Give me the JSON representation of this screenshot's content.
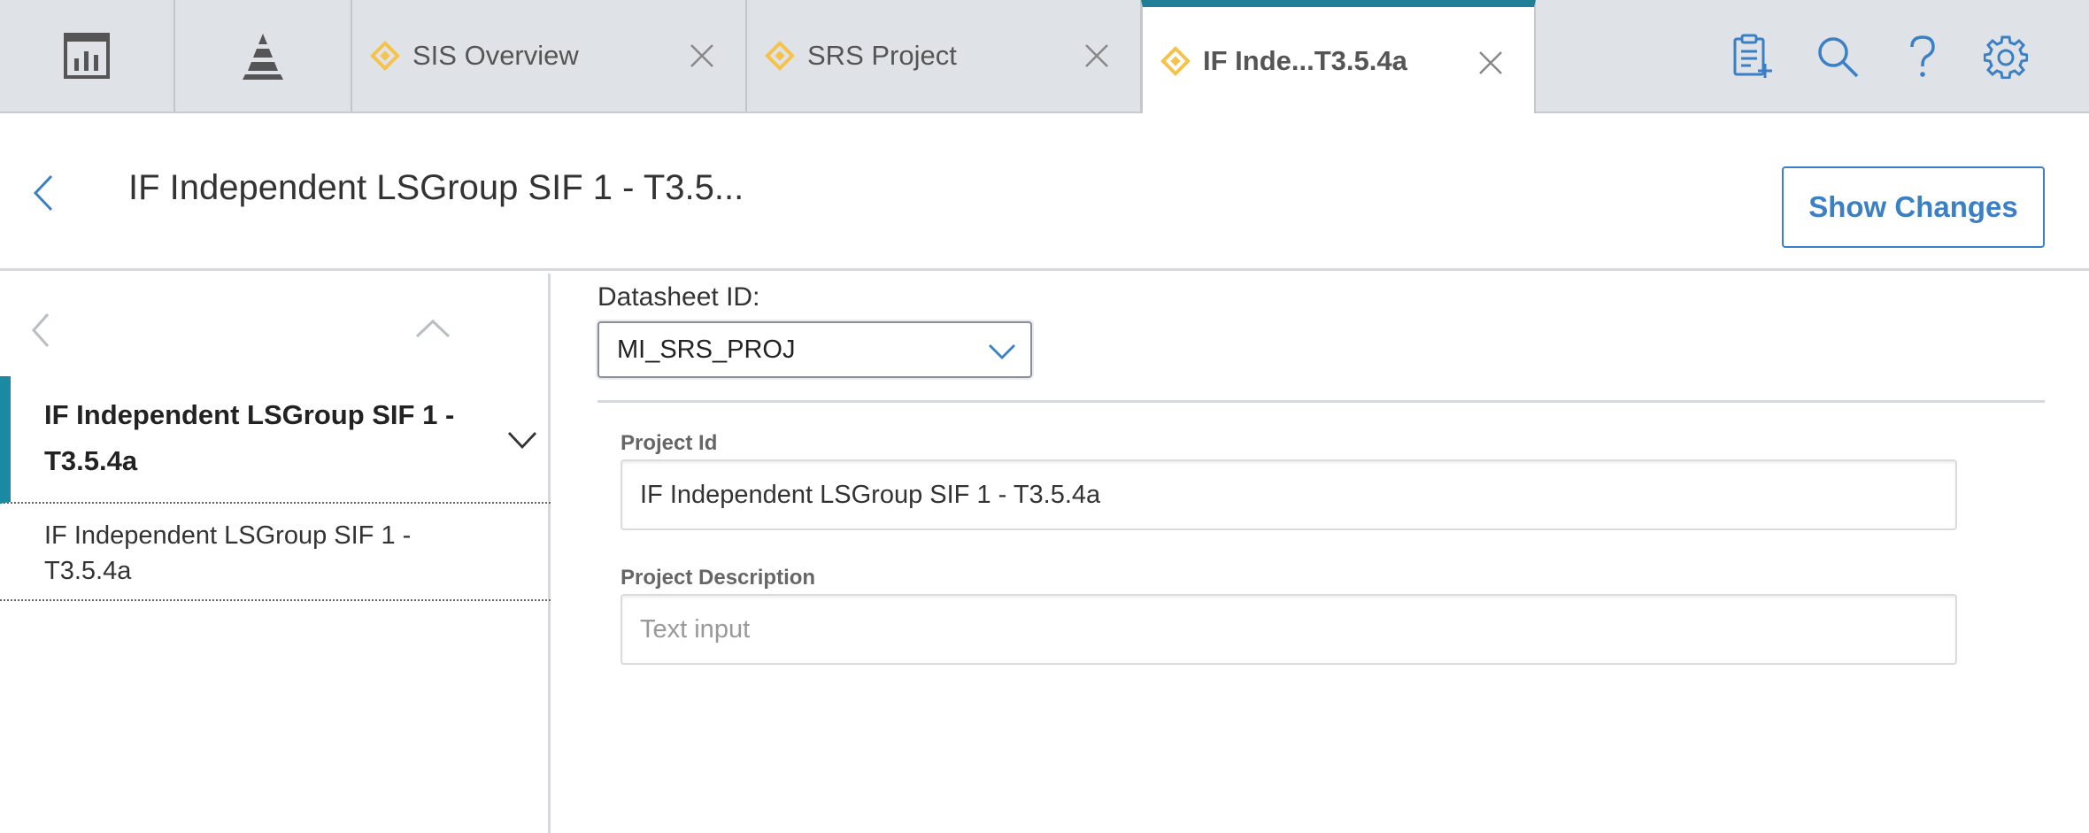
{
  "tabs": {
    "app_tabs": [
      {
        "icon": "dashboard-chart-icon"
      },
      {
        "icon": "pyramid-icon"
      }
    ],
    "documents": [
      {
        "label": "SIS Overview",
        "icon": "diamond-icon",
        "active": false
      },
      {
        "label": "SRS Project",
        "icon": "diamond-icon",
        "active": false
      },
      {
        "label": "IF Inde...T3.5.4a",
        "icon": "diamond-icon",
        "active": true
      }
    ],
    "tools": [
      {
        "icon": "clipboard-add-icon"
      },
      {
        "icon": "search-icon"
      },
      {
        "icon": "help-icon"
      },
      {
        "icon": "gear-icon"
      }
    ]
  },
  "header": {
    "title": "IF Independent LSGroup SIF 1 - T3.5...",
    "show_changes_label": "Show Changes"
  },
  "left_panel": {
    "tree": {
      "parent_label": "IF Independent LSGroup SIF 1 - T3.5.4a",
      "child_label": "IF Independent LSGroup SIF 1 - T3.5.4a"
    }
  },
  "main": {
    "datasheet_label": "Datasheet ID:",
    "datasheet_value": "MI_SRS_PROJ",
    "fields": {
      "project_id_label": "Project Id",
      "project_id_value": "IF Independent LSGroup SIF 1 - T3.5.4a",
      "project_desc_label": "Project Description",
      "project_desc_placeholder": "Text input"
    }
  },
  "colors": {
    "accent_teal": "#1e7f96",
    "link_blue": "#3b7fc4",
    "diamond_yellow": "#f5c24c",
    "tabbar_bg": "#dfe3e8"
  }
}
